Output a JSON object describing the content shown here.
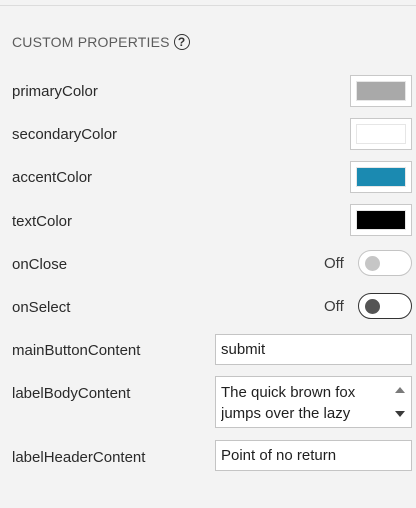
{
  "section": {
    "title": "CUSTOM PROPERTIES",
    "help_icon": "question-circle-icon"
  },
  "colors": [
    {
      "label": "primaryColor",
      "value": "#a9a9a9"
    },
    {
      "label": "secondaryColor",
      "value": "#ffffff"
    },
    {
      "label": "accentColor",
      "value": "#1b8ab1"
    },
    {
      "label": "textColor",
      "value": "#000000"
    }
  ],
  "toggles": [
    {
      "label": "onClose",
      "state": "Off",
      "enabled": false
    },
    {
      "label": "onSelect",
      "state": "Off",
      "enabled": true
    }
  ],
  "fields": {
    "mainButtonContent": {
      "label": "mainButtonContent",
      "value": "submit"
    },
    "labelBodyContent": {
      "label": "labelBodyContent",
      "value": "The quick brown fox jumps over the lazy"
    },
    "labelHeaderContent": {
      "label": "labelHeaderContent",
      "value": "Point of no return"
    }
  }
}
